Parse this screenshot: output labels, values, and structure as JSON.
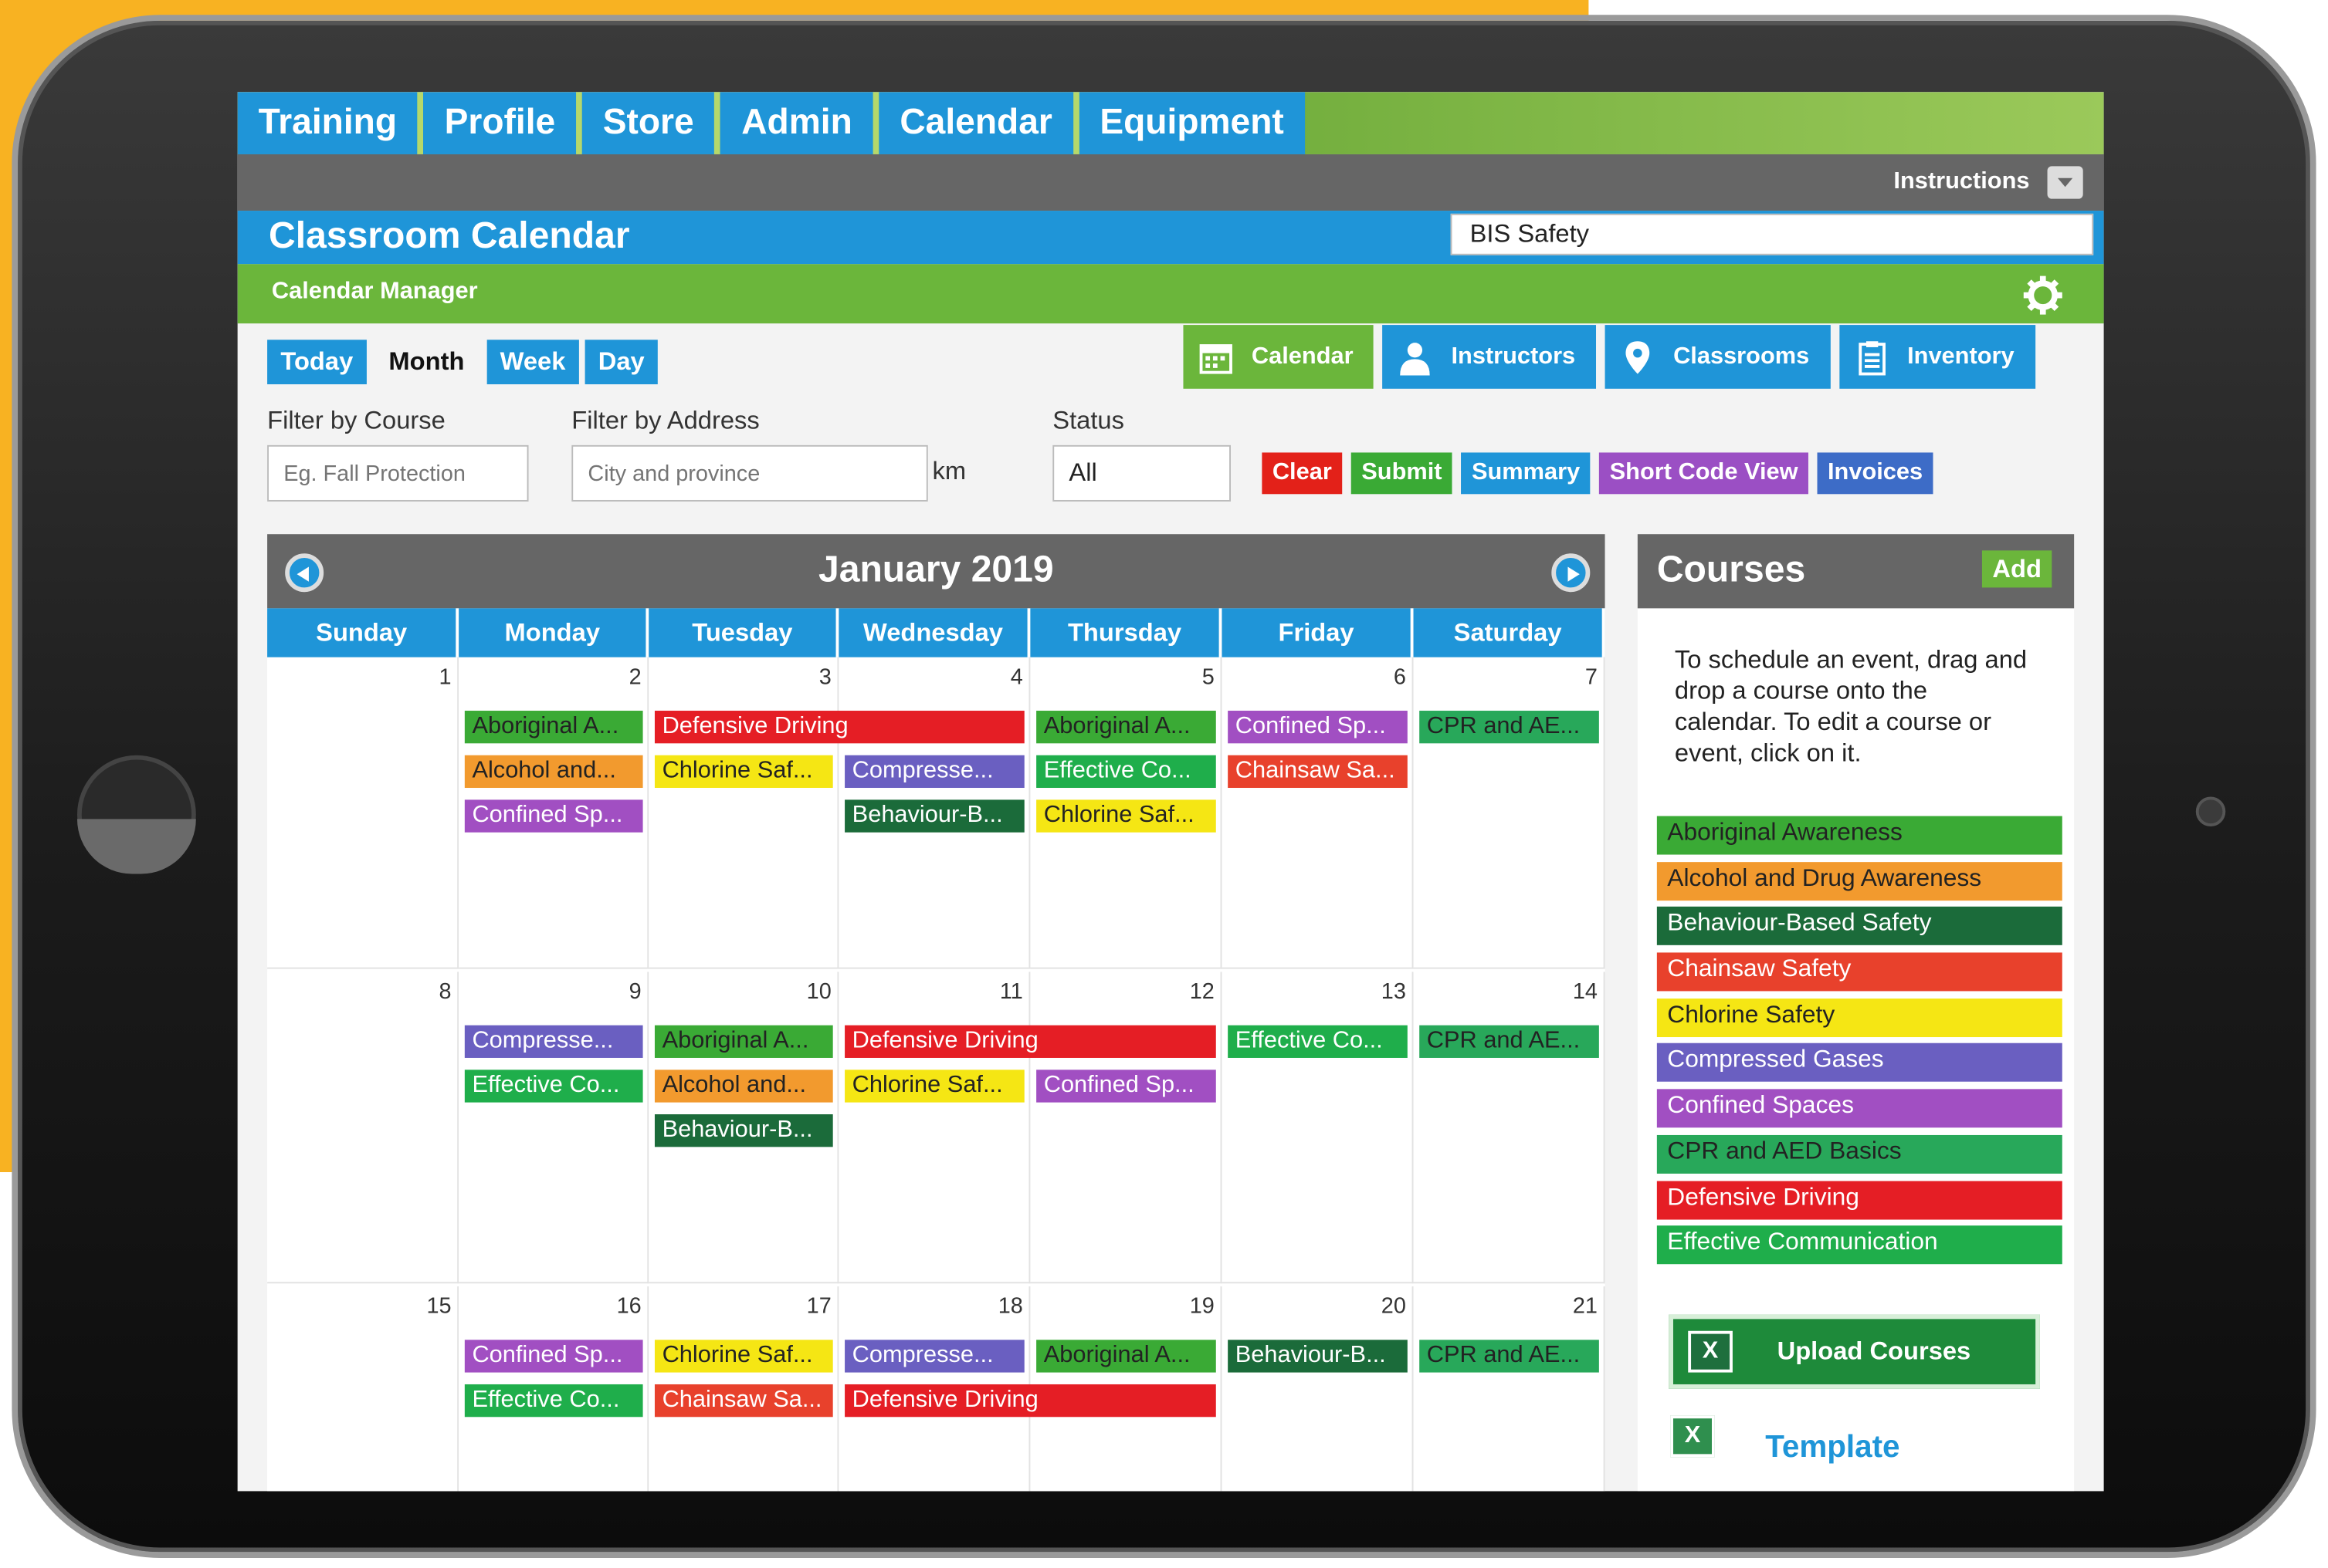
{
  "colors": {
    "blue": "#1f95d8",
    "green": "#6bb63b",
    "grey": "#666666",
    "orange_bg": "#f8b222"
  },
  "nav": {
    "tabs": [
      "Training",
      "Profile",
      "Store",
      "Admin",
      "Calendar",
      "Equipment"
    ]
  },
  "instructions_label": "Instructions",
  "page": {
    "title": "Classroom Calendar",
    "subtitle": "Calendar Manager",
    "organization": "BIS Safety"
  },
  "view_tabs": [
    {
      "label": "Today",
      "active": false
    },
    {
      "label": "Month",
      "active": true
    },
    {
      "label": "Week",
      "active": false
    },
    {
      "label": "Day",
      "active": false
    }
  ],
  "section_tabs": [
    {
      "label": "Calendar",
      "icon": "calendar-icon",
      "active": true
    },
    {
      "label": "Instructors",
      "icon": "person-icon",
      "active": false
    },
    {
      "label": "Classrooms",
      "icon": "location-pin-icon",
      "active": false
    },
    {
      "label": "Inventory",
      "icon": "clipboard-icon",
      "active": false
    }
  ],
  "filters": {
    "course_label": "Filter by Course",
    "course_placeholder": "Eg. Fall Protection",
    "address_label": "Filter by Address",
    "address_placeholder": "City and province",
    "km_label": "km",
    "status_label": "Status",
    "status_value": "All"
  },
  "actions": [
    {
      "label": "Clear",
      "color": "#e32119"
    },
    {
      "label": "Submit",
      "color": "#3aaa35"
    },
    {
      "label": "Summary",
      "color": "#1f95d8"
    },
    {
      "label": "Short Code View",
      "color": "#9b4fc4"
    },
    {
      "label": "Invoices",
      "color": "#3d6cc7"
    }
  ],
  "calendar": {
    "month_label": "January 2019",
    "weekdays": [
      "Sunday",
      "Monday",
      "Tuesday",
      "Wednesday",
      "Thursday",
      "Friday",
      "Saturday"
    ],
    "weeks": [
      {
        "days": [
          "1",
          "2",
          "3",
          "4",
          "5",
          "6",
          "7"
        ],
        "events": [
          {
            "label": "Aboriginal A...",
            "course": "aboriginal",
            "day": 1,
            "span": 1,
            "row": 0
          },
          {
            "label": "Alcohol and...",
            "course": "alcohol",
            "day": 1,
            "span": 1,
            "row": 1
          },
          {
            "label": "Confined Sp...",
            "course": "confined",
            "day": 1,
            "span": 1,
            "row": 2
          },
          {
            "label": "Defensive Driving",
            "course": "defensive",
            "day": 2,
            "span": 2,
            "row": 0
          },
          {
            "label": "Chlorine Saf...",
            "course": "chlorine",
            "day": 2,
            "span": 1,
            "row": 1
          },
          {
            "label": "Compresse...",
            "course": "compressed",
            "day": 3,
            "span": 1,
            "row": 1
          },
          {
            "label": "Behaviour-B...",
            "course": "behaviour",
            "day": 3,
            "span": 1,
            "row": 2
          },
          {
            "label": "Aboriginal A...",
            "course": "aboriginal",
            "day": 4,
            "span": 1,
            "row": 0
          },
          {
            "label": "Effective Co...",
            "course": "effective",
            "day": 4,
            "span": 1,
            "row": 1
          },
          {
            "label": "Chlorine Saf...",
            "course": "chlorine",
            "day": 4,
            "span": 1,
            "row": 2
          },
          {
            "label": "Confined Sp...",
            "course": "confined",
            "day": 5,
            "span": 1,
            "row": 0
          },
          {
            "label": "Chainsaw Sa...",
            "course": "chainsaw",
            "day": 5,
            "span": 1,
            "row": 1
          },
          {
            "label": "CPR and AE...",
            "course": "cpr",
            "day": 6,
            "span": 1,
            "row": 0
          }
        ]
      },
      {
        "days": [
          "8",
          "9",
          "10",
          "11",
          "12",
          "13",
          "14"
        ],
        "events": [
          {
            "label": "Compresse...",
            "course": "compressed",
            "day": 1,
            "span": 1,
            "row": 0
          },
          {
            "label": "Effective Co...",
            "course": "effective",
            "day": 1,
            "span": 1,
            "row": 1
          },
          {
            "label": "Aboriginal A...",
            "course": "aboriginal",
            "day": 2,
            "span": 1,
            "row": 0
          },
          {
            "label": "Alcohol and...",
            "course": "alcohol",
            "day": 2,
            "span": 1,
            "row": 1
          },
          {
            "label": "Behaviour-B...",
            "course": "behaviour",
            "day": 2,
            "span": 1,
            "row": 2
          },
          {
            "label": "Defensive Driving",
            "course": "defensive",
            "day": 3,
            "span": 2,
            "row": 0
          },
          {
            "label": "Chlorine Saf...",
            "course": "chlorine",
            "day": 3,
            "span": 1,
            "row": 1
          },
          {
            "label": "Confined Sp...",
            "course": "confined",
            "day": 4,
            "span": 1,
            "row": 1
          },
          {
            "label": "Effective Co...",
            "course": "effective",
            "day": 5,
            "span": 1,
            "row": 0
          },
          {
            "label": "CPR and AE...",
            "course": "cpr",
            "day": 6,
            "span": 1,
            "row": 0
          }
        ]
      },
      {
        "days": [
          "15",
          "16",
          "17",
          "18",
          "19",
          "20",
          "21"
        ],
        "events": [
          {
            "label": "Confined Sp...",
            "course": "confined",
            "day": 1,
            "span": 1,
            "row": 0
          },
          {
            "label": "Effective Co...",
            "course": "effective",
            "day": 1,
            "span": 1,
            "row": 1
          },
          {
            "label": "Chlorine Saf...",
            "course": "chlorine",
            "day": 2,
            "span": 1,
            "row": 0
          },
          {
            "label": "Chainsaw Sa...",
            "course": "chainsaw",
            "day": 2,
            "span": 1,
            "row": 1
          },
          {
            "label": "Compresse...",
            "course": "compressed",
            "day": 3,
            "span": 1,
            "row": 0
          },
          {
            "label": "Defensive Driving",
            "course": "defensive",
            "day": 3,
            "span": 2,
            "row": 1
          },
          {
            "label": "Aboriginal A...",
            "course": "aboriginal",
            "day": 4,
            "span": 1,
            "row": 0
          },
          {
            "label": "Behaviour-B...",
            "course": "behaviour",
            "day": 5,
            "span": 1,
            "row": 0
          },
          {
            "label": "CPR and AE...",
            "course": "cpr",
            "day": 6,
            "span": 1,
            "row": 0
          }
        ]
      }
    ]
  },
  "courses": {
    "title": "Courses",
    "add_label": "Add",
    "instructions": "To schedule an event, drag and drop a course onto the calendar. To edit a course or event, click on it.",
    "items": [
      {
        "key": "aboriginal",
        "label": "Aboriginal Awareness",
        "color": "#3aaa35",
        "text_color": "#222222"
      },
      {
        "key": "alcohol",
        "label": "Alcohol and Drug Awareness",
        "color": "#f29a2e",
        "text_color": "#222222"
      },
      {
        "key": "behaviour",
        "label": "Behaviour-Based Safety",
        "color": "#1b6b3a",
        "text_color": "#ffffff"
      },
      {
        "key": "chainsaw",
        "label": "Chainsaw Safety",
        "color": "#e8412c",
        "text_color": "#ffffff"
      },
      {
        "key": "chlorine",
        "label": "Chlorine Safety",
        "color": "#f5e614",
        "text_color": "#222222"
      },
      {
        "key": "compressed",
        "label": "Compressed Gases",
        "color": "#6a5fc1",
        "text_color": "#ffffff"
      },
      {
        "key": "confined",
        "label": "Confined Spaces",
        "color": "#a14fc2",
        "text_color": "#ffffff"
      },
      {
        "key": "cpr",
        "label": "CPR and AED Basics",
        "color": "#28a85a",
        "text_color": "#222222"
      },
      {
        "key": "defensive",
        "label": "Defensive Driving",
        "color": "#e51e25",
        "text_color": "#ffffff"
      },
      {
        "key": "effective",
        "label": "Effective Communication",
        "color": "#1fae4b",
        "text_color": "#ffffff"
      }
    ],
    "upload_label": "Upload Courses",
    "template_label": "Template"
  }
}
